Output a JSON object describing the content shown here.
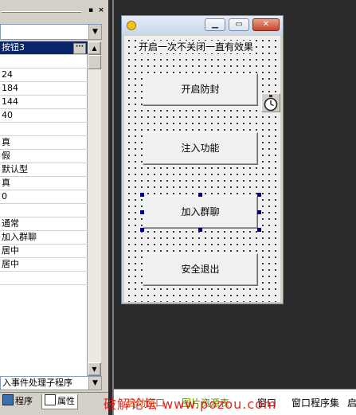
{
  "property_panel": {
    "title_buttons": [
      "▪",
      "×"
    ],
    "object_combo": "",
    "rows": [
      "按钮3",
      "",
      "24",
      "184",
      "144",
      "40",
      "",
      "真",
      "假",
      "默认型",
      "真",
      "0",
      "",
      "通常",
      "加入群聊",
      "居中",
      "居中",
      "",
      "",
      "",
      "",
      "",
      "",
      ""
    ],
    "selected_row": 0,
    "event_combo": "入事件处理子程序",
    "tabs": [
      "程序",
      "属性"
    ]
  },
  "form": {
    "label": "开启一次不关闭一直有效果",
    "buttons": [
      "开启防封",
      "注入功能",
      "加入群聊",
      "安全退出"
    ],
    "selected_button": "加入群聊",
    "caption_buttons": [
      "minimize",
      "maximize",
      "close"
    ]
  },
  "bottom_tabs": [
    "启动窗口",
    "图片资源表",
    "窗口",
    "窗口程序集",
    "启"
  ],
  "watermark": "破解论坛 www.pozou.com",
  "colors": {
    "accent": "#0a246a",
    "handle": "#000080",
    "watermark": "#e01010"
  },
  "icons": {
    "timer": "stopwatch-icon",
    "app": "app-icon"
  }
}
